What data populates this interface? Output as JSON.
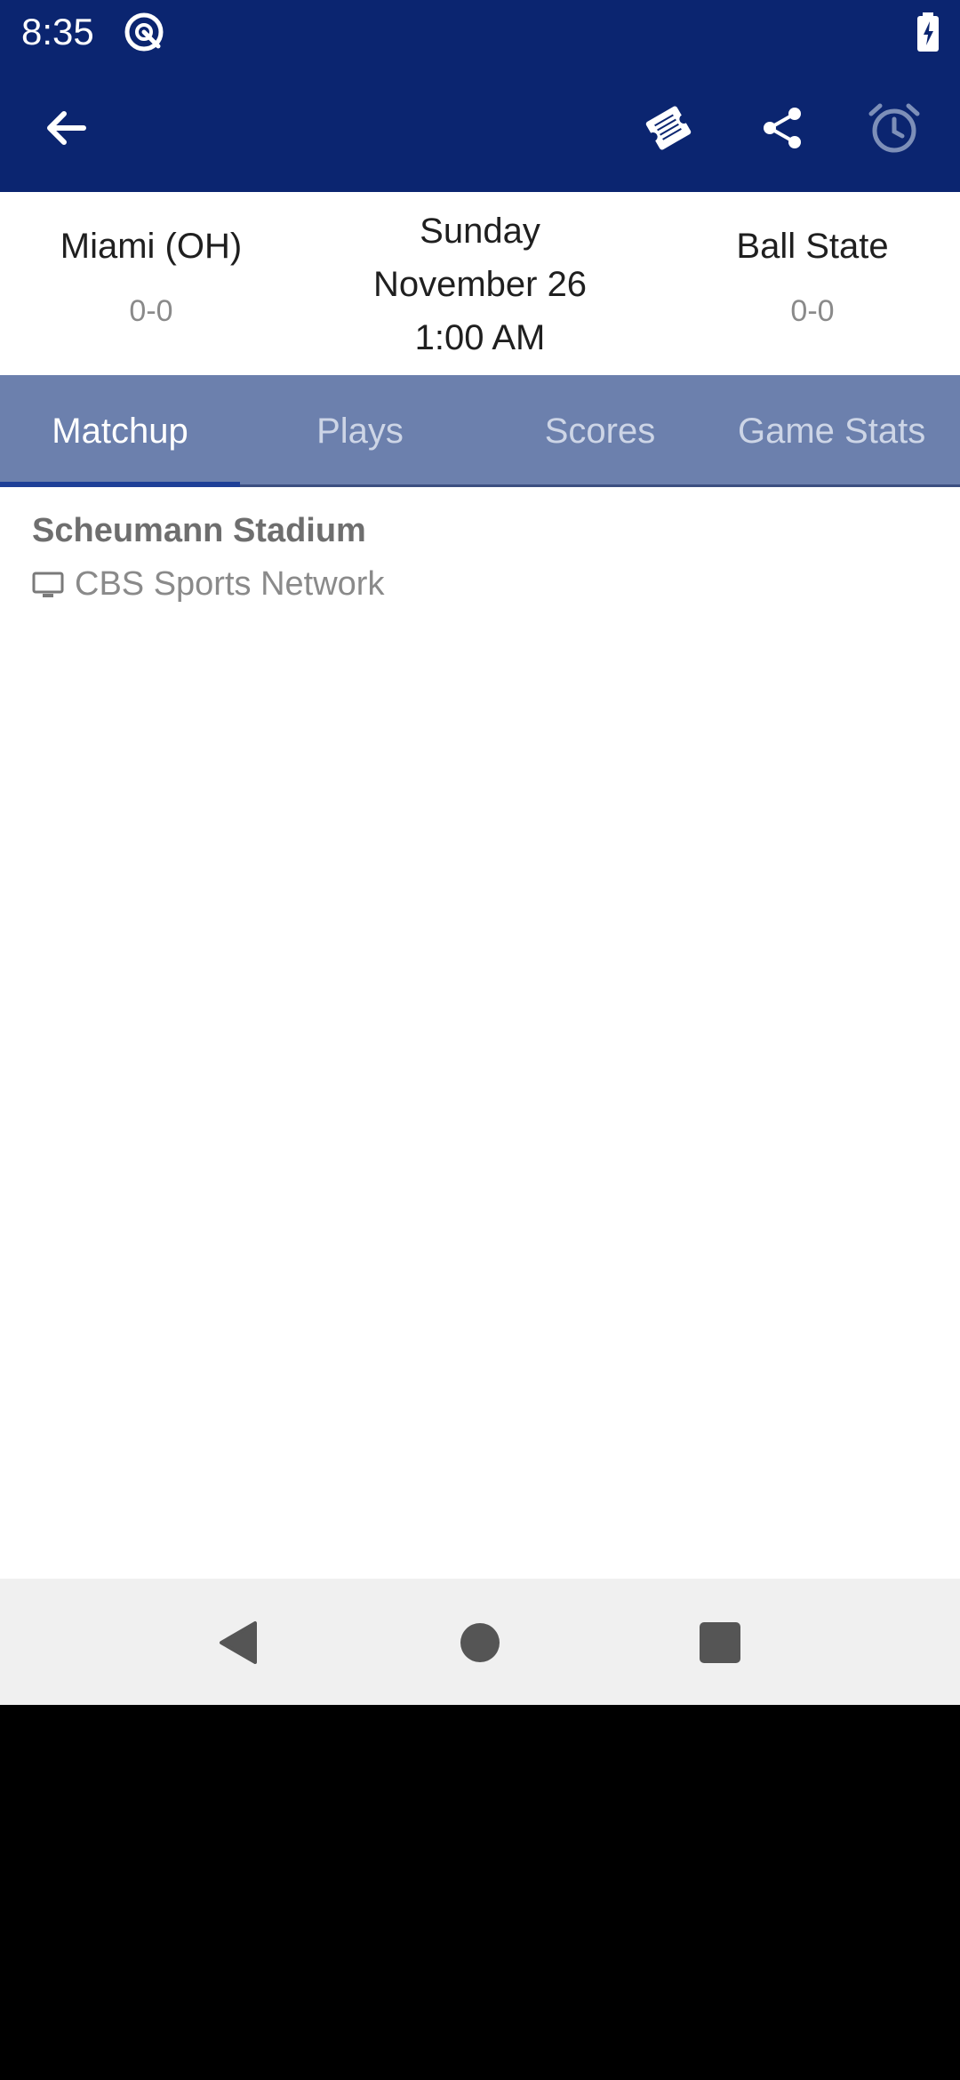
{
  "status_bar": {
    "time": "8:35"
  },
  "app_bar": {
    "icons": [
      "back-arrow-icon",
      "ticket-icon",
      "share-icon",
      "alarm-icon"
    ]
  },
  "matchup": {
    "away_team": {
      "name": "Miami (OH)",
      "record": "0-0"
    },
    "home_team": {
      "name": "Ball State",
      "record": "0-0"
    },
    "date": {
      "day": "Sunday",
      "date": "November 26",
      "time": "1:00 AM"
    }
  },
  "tabs": [
    {
      "label": "Matchup",
      "active": true
    },
    {
      "label": "Plays",
      "active": false
    },
    {
      "label": "Scores",
      "active": false
    },
    {
      "label": "Game Stats",
      "active": false
    }
  ],
  "details": {
    "venue": "Scheumann Stadium",
    "broadcast": "CBS Sports Network"
  },
  "colors": {
    "header_bg": "#0b2570",
    "tab_bg": "#6c80ad",
    "tab_indicator": "#1e3f97",
    "nav_bar_bg": "#f0f0f0"
  }
}
